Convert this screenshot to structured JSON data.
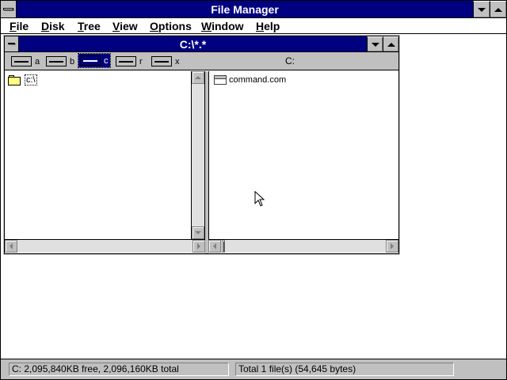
{
  "app": {
    "title": "File Manager",
    "menu": [
      "File",
      "Disk",
      "Tree",
      "View",
      "Options",
      "Window",
      "Help"
    ],
    "menu_underline": [
      "F",
      "D",
      "T",
      "V",
      "O",
      "W",
      "H"
    ]
  },
  "child": {
    "title": "C:\\*.*",
    "drives": [
      {
        "letter": "a",
        "icon": "floppy-drive-icon",
        "selected": false
      },
      {
        "letter": "b",
        "icon": "floppy-drive-icon",
        "selected": false
      },
      {
        "letter": "c",
        "icon": "hard-drive-icon",
        "selected": true
      },
      {
        "letter": "r",
        "icon": "cdrom-drive-icon",
        "selected": false
      },
      {
        "letter": "x",
        "icon": "network-drive-icon",
        "selected": false
      }
    ],
    "current_path_label": "C:",
    "tree": {
      "items": [
        {
          "label": "c:\\",
          "icon": "open-folder-icon"
        }
      ]
    },
    "files": {
      "items": [
        {
          "name": "command.com",
          "icon": "program-file-icon"
        }
      ]
    }
  },
  "status": {
    "left": "C: 2,095,840KB free,  2,096,160KB total",
    "right": "Total 1 file(s) (54,645 bytes)"
  },
  "colors": {
    "titlebar": "#000080",
    "face": "#c0c0c0",
    "window": "#ffffff"
  }
}
